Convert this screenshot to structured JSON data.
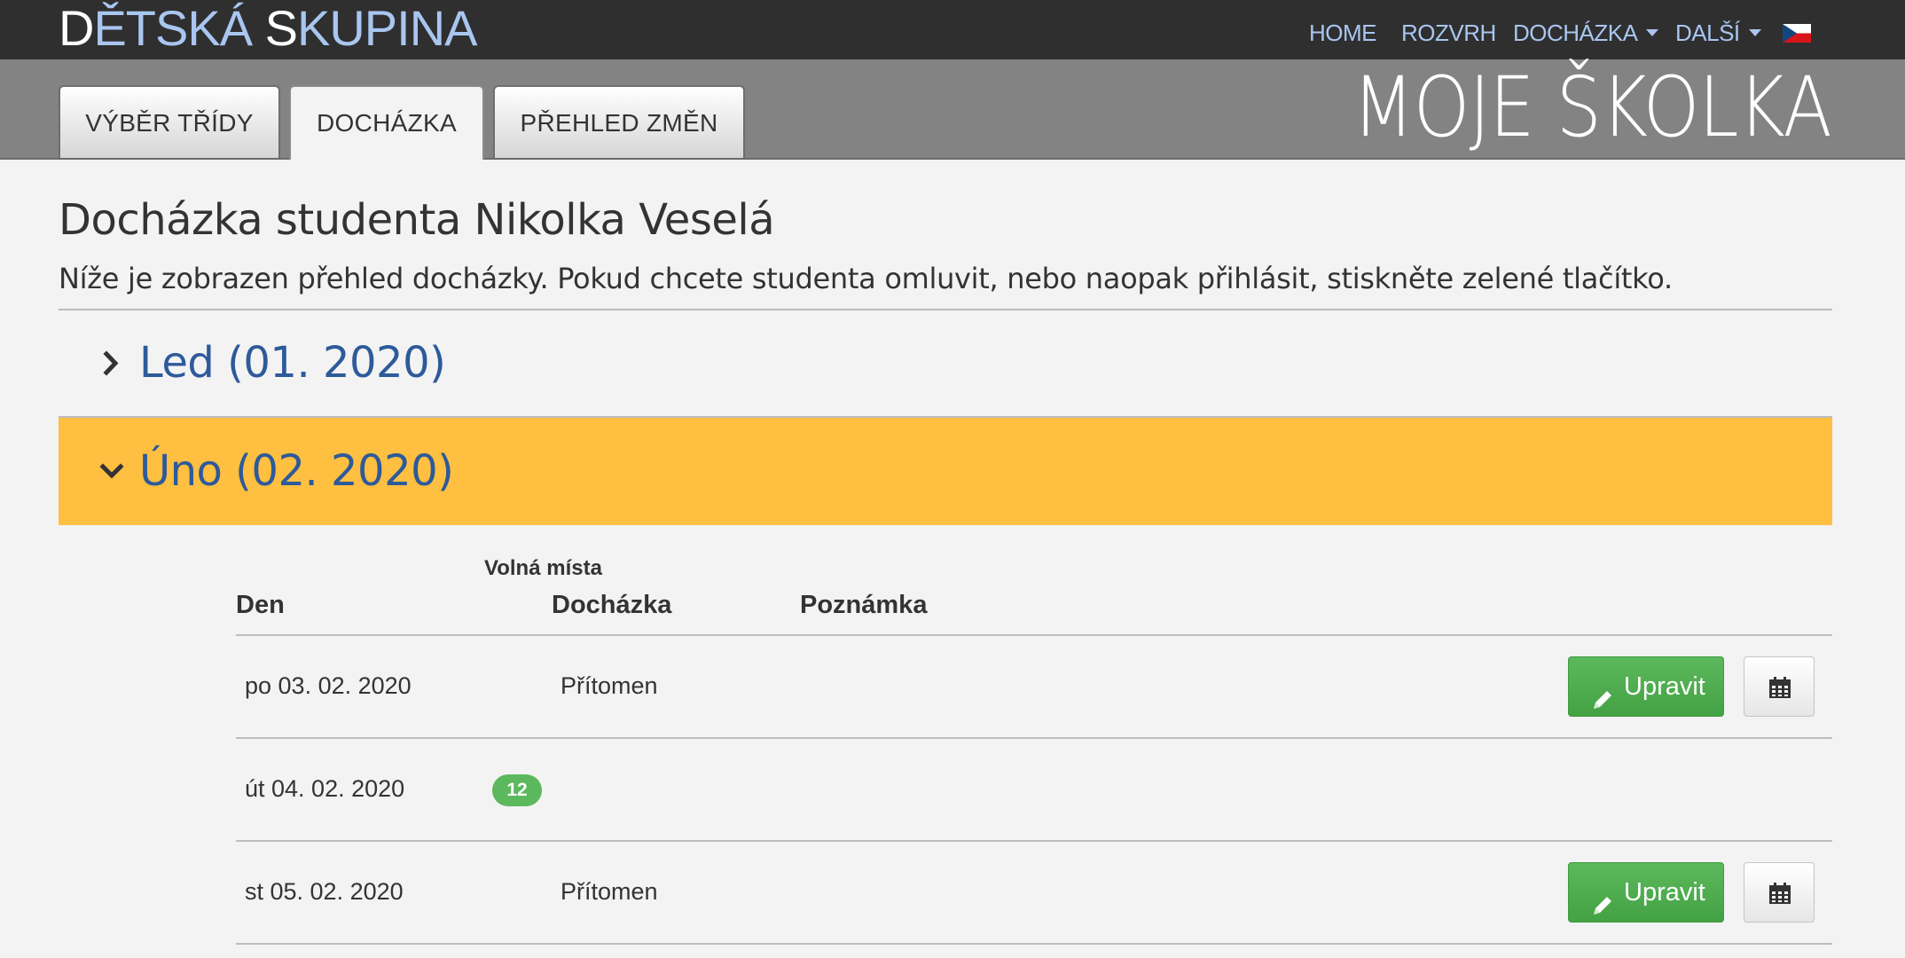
{
  "header": {
    "brand_first": "D",
    "brand_hl1": "ĚTSKÁ ",
    "brand_second": "S",
    "brand_hl2": "KUPINA",
    "nav": [
      {
        "label": "HOME"
      },
      {
        "label": "ROZVRH"
      },
      {
        "label": "DOCHÁZKA",
        "dropdown": true
      },
      {
        "label": "DALŠÍ",
        "dropdown": true
      }
    ],
    "flag_icon": "czech-flag-icon"
  },
  "tabs": [
    {
      "label": "VÝBĚR TŘÍDY",
      "active": false
    },
    {
      "label": "DOCHÁZKA",
      "active": true
    },
    {
      "label": "PŘEHLED ZMĚN",
      "active": false
    }
  ],
  "logo": "MOJE ŠKOLKA",
  "page": {
    "title": "Docházka studenta Nikolka Veselá",
    "description": "Níže je zobrazen přehled docházky. Pokud chcete studenta omluvit, nebo naopak přihlásit, stiskněte zelené tlačítko."
  },
  "months": [
    {
      "label": "Led (01. 2020)",
      "expanded": false
    },
    {
      "label": "Úno (02. 2020)",
      "expanded": true,
      "highlight_color": "#ffbf40"
    }
  ],
  "table": {
    "headers": {
      "day": "Den",
      "free_places": "Volná místa",
      "attendance": "Docházka",
      "note": "Poznámka"
    },
    "rows": [
      {
        "day": "po 03. 02. 2020",
        "free_places": "",
        "attendance": "Přítomen",
        "note": "",
        "edit_label": "Upravit",
        "has_actions": true
      },
      {
        "day": "út 04. 02. 2020",
        "free_places": "12",
        "attendance": "",
        "note": "",
        "edit_label": "",
        "has_actions": false
      },
      {
        "day": "st 05. 02. 2020",
        "free_places": "",
        "attendance": "Přítomen",
        "note": "",
        "edit_label": "Upravit",
        "has_actions": true
      }
    ]
  },
  "colors": {
    "navbar": "#2f2f2f",
    "band": "#838383",
    "link": "#2d5a9a",
    "success": "#5cb85c",
    "highlight": "#ffbf40"
  }
}
